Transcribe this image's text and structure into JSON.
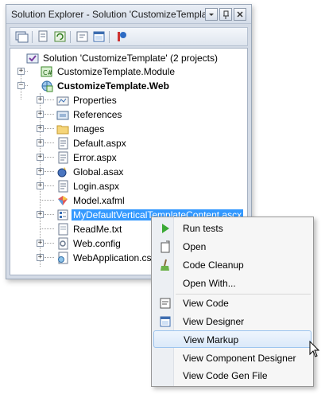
{
  "window": {
    "title": "Solution Explorer - Solution 'CustomizeTemplate' ...",
    "buttons": [
      "chevron-down-icon",
      "pin-icon",
      "close-icon"
    ]
  },
  "toolbar": {
    "icons": [
      "solution-icon",
      "properties-icon",
      "refresh-icon",
      "view-code-icon",
      "view-designer-icon",
      "class-diagram-icon"
    ]
  },
  "tree": {
    "solution": "Solution 'CustomizeTemplate' (2 projects)",
    "module": "CustomizeTemplate.Module",
    "web": "CustomizeTemplate.Web",
    "items": [
      "Properties",
      "References",
      "Images",
      "Default.aspx",
      "Error.aspx",
      "Global.asax",
      "Login.aspx",
      "Model.xafml",
      "MyDefaultVerticalTemplateContent.ascx",
      "ReadMe.txt",
      "Web.config",
      "WebApplication.cs"
    ]
  },
  "context_menu": {
    "items": [
      "Run tests",
      "Open",
      "Code Cleanup",
      "Open With...",
      "View Code",
      "View Designer",
      "View Markup",
      "View Component Designer",
      "View Code Gen File"
    ],
    "hovered": "View Markup"
  }
}
